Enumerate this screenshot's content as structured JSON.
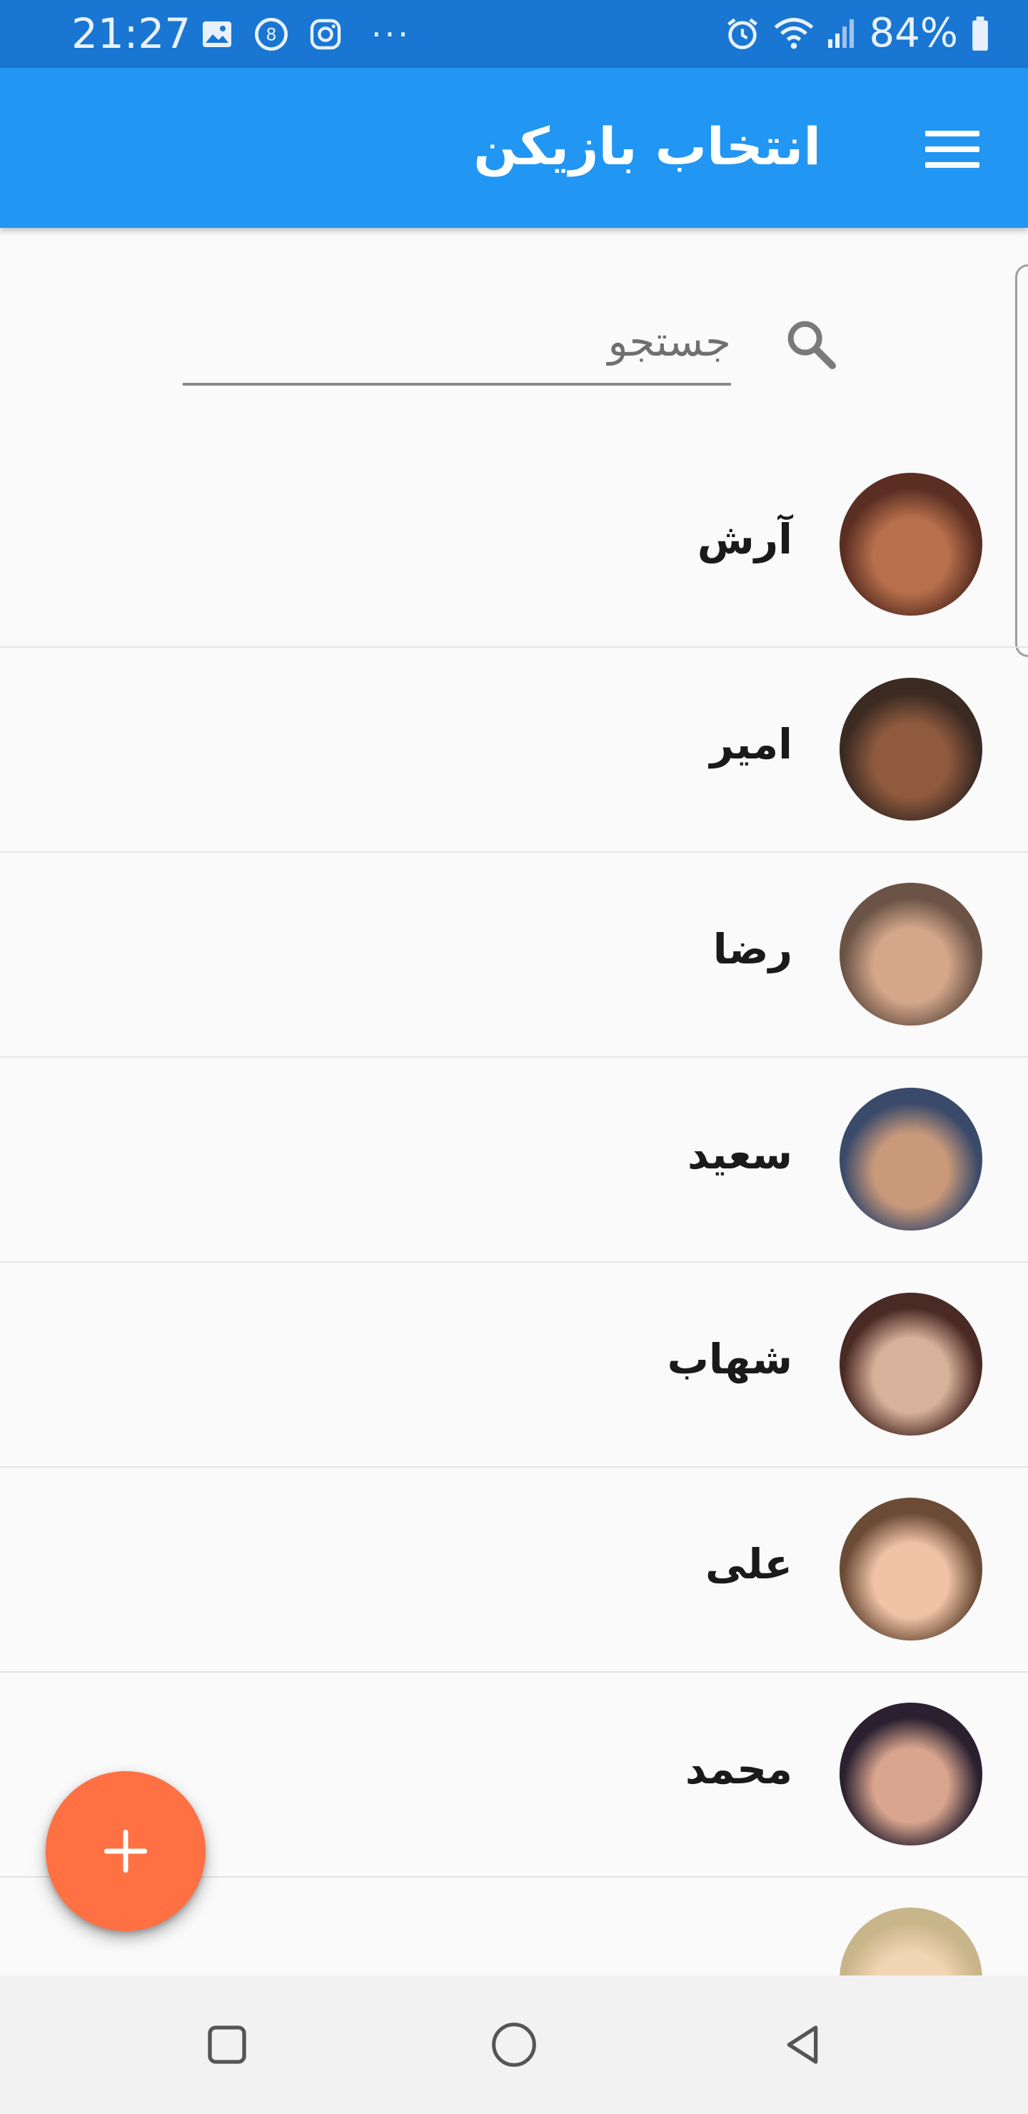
{
  "status_bar": {
    "time": "21:27",
    "battery": "84%",
    "more": "···",
    "left_icons": [
      "image-icon",
      "sync-icon",
      "instagram-icon"
    ],
    "right_icons": [
      "alarm-icon",
      "wifi-icon",
      "signal-icon",
      "battery-icon"
    ]
  },
  "app_bar": {
    "title": "انتخاب بازیکن",
    "menu_icon": "menu-icon",
    "color": "#2196f3"
  },
  "search": {
    "placeholder": "جستجو",
    "value": ""
  },
  "players": [
    {
      "name": "آرش",
      "avatar_colors": [
        "#5a2e22",
        "#b8704c"
      ]
    },
    {
      "name": "امیر",
      "avatar_colors": [
        "#3b2a22",
        "#8f5a3e"
      ]
    },
    {
      "name": "رضا",
      "avatar_colors": [
        "#6b5346",
        "#d4a78a"
      ]
    },
    {
      "name": "سعید",
      "avatar_colors": [
        "#3a4a6a",
        "#c9997a"
      ]
    },
    {
      "name": "شهاب",
      "avatar_colors": [
        "#4a2a24",
        "#d8b19a"
      ]
    },
    {
      "name": "علی",
      "avatar_colors": [
        "#6b4a36",
        "#efc3a6"
      ]
    },
    {
      "name": "محمد",
      "avatar_colors": [
        "#2a2030",
        "#d9a58e"
      ]
    },
    {
      "name": "",
      "avatar_colors": [
        "#c9b58a",
        "#f1d6b5"
      ]
    }
  ],
  "fab": {
    "icon": "plus-icon",
    "color": "#ff7043"
  },
  "nav_bar": {
    "buttons": [
      "recent-apps-icon",
      "home-icon",
      "back-icon"
    ]
  }
}
